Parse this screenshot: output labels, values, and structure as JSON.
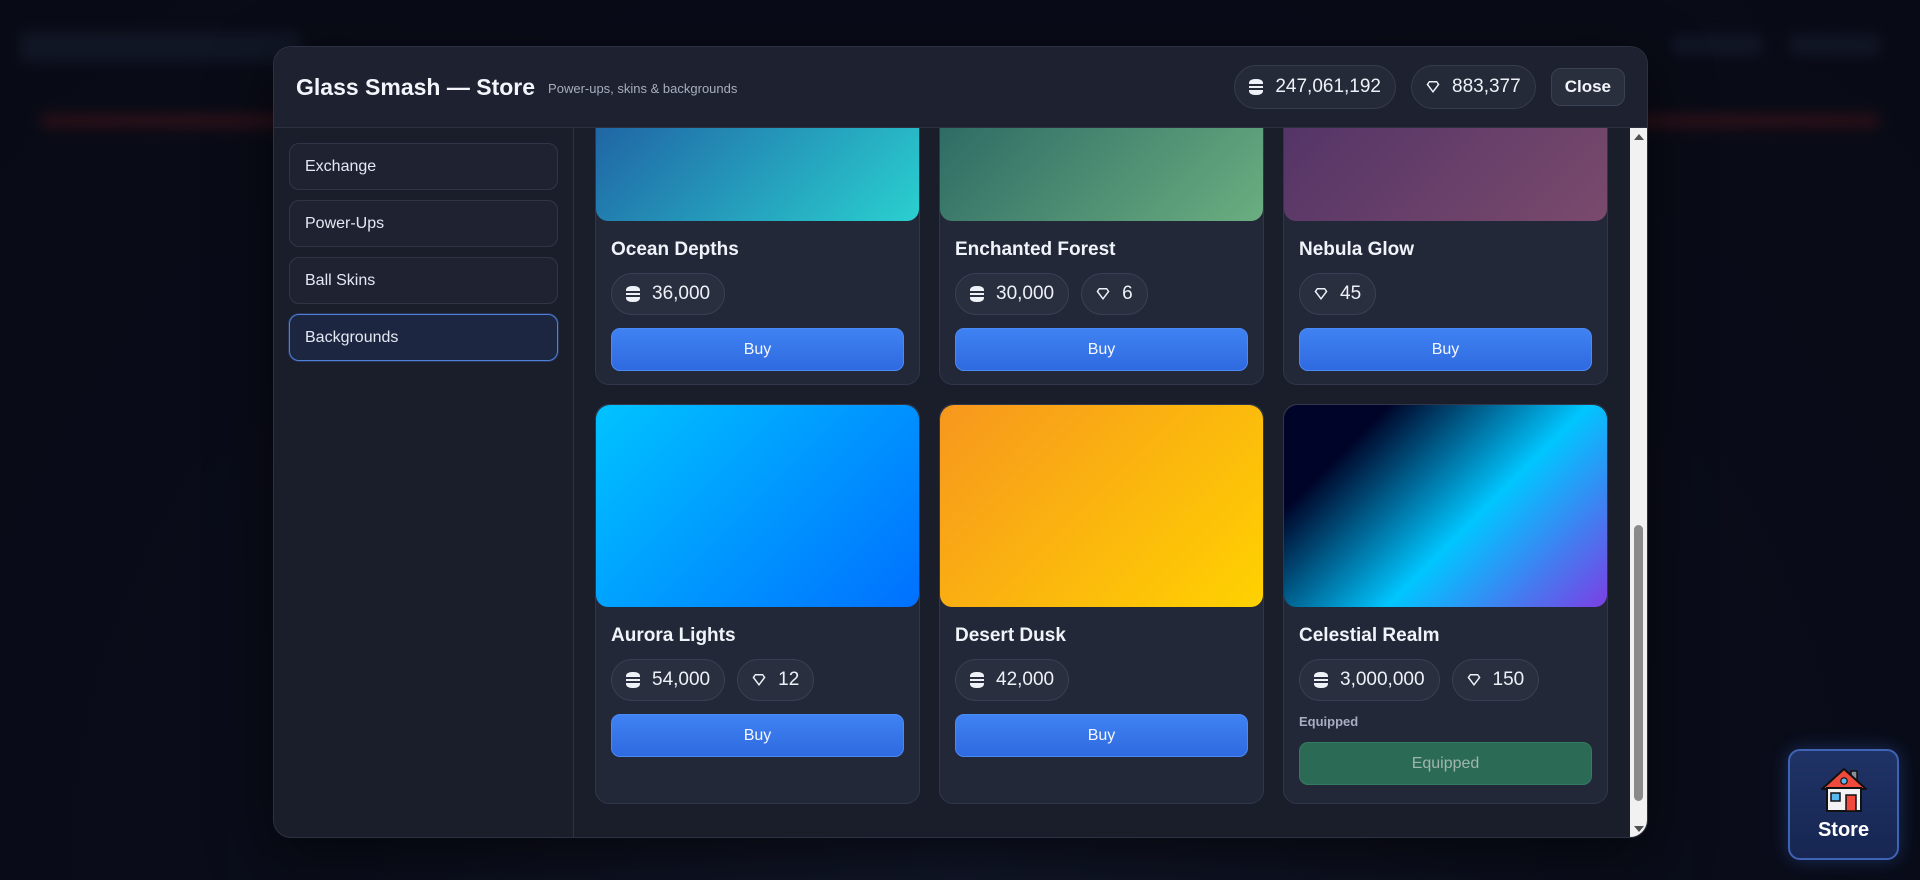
{
  "modal": {
    "title": "Glass Smash — Store",
    "subtitle": "Power-ups, skins & backgrounds",
    "coins": "247,061,192",
    "gems": "883,377",
    "close_label": "Close"
  },
  "sidebar": {
    "items": [
      {
        "label": "Exchange",
        "active": false
      },
      {
        "label": "Power-Ups",
        "active": false
      },
      {
        "label": "Ball Skins",
        "active": false
      },
      {
        "label": "Backgrounds",
        "active": true
      }
    ]
  },
  "cards": [
    {
      "name": "Ocean Depths",
      "coins": "36,000",
      "gems": null,
      "action": "Buy",
      "gradient": [
        "#1d4a9a",
        "#2ad0d0"
      ]
    },
    {
      "name": "Enchanted Forest",
      "coins": "30,000",
      "gems": "6",
      "action": "Buy",
      "gradient": [
        "#1f5a5e",
        "#6bae80"
      ]
    },
    {
      "name": "Nebula Glow",
      "coins": null,
      "gems": "45",
      "action": "Buy",
      "gradient": [
        "#4a2f66",
        "#7a4a6c"
      ]
    },
    {
      "name": "Aurora Lights",
      "coins": "54,000",
      "gems": "12",
      "action": "Buy",
      "gradient": [
        "#00c3ff",
        "#0070ff"
      ]
    },
    {
      "name": "Desert Dusk",
      "coins": "42,000",
      "gems": null,
      "action": "Buy",
      "gradient": [
        "#f7971e",
        "#ffd200"
      ]
    },
    {
      "name": "Celestial Realm",
      "coins": "3,000,000",
      "gems": "150",
      "status": "Equipped",
      "action": "Equipped",
      "gradient": [
        "#000428",
        "#00c6ff",
        "#7b3fe4"
      ]
    }
  ],
  "fab": {
    "label": "Store",
    "icon": "house-icon"
  },
  "colors": {
    "accent": "#3f82f2",
    "equipped": "#2b6b55",
    "modal_bg": "#1a1e2b"
  }
}
